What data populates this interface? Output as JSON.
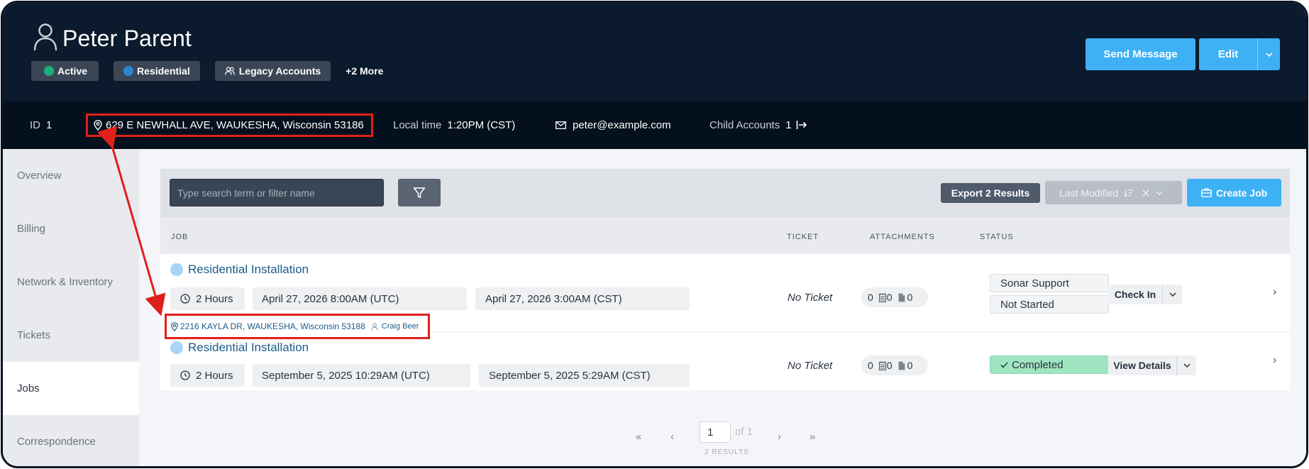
{
  "header": {
    "name": "Peter Parent",
    "tags": [
      {
        "label": "Active",
        "color": "#1bb07a"
      },
      {
        "label": "Residential",
        "color": "#2c86d0"
      },
      {
        "label": "Legacy Accounts"
      }
    ],
    "more_label": "+2 More",
    "send_message_label": "Send Message",
    "edit_label": "Edit"
  },
  "info": {
    "id_label": "ID",
    "id_value": "1",
    "address": "629 E NEWHALL AVE, WAUKESHA, Wisconsin 53186",
    "local_time_label": "Local time",
    "local_time_value": "1:20PM (CST)",
    "email": "peter@example.com",
    "child_accounts_label": "Child Accounts",
    "child_accounts_value": "1"
  },
  "sidebar": {
    "items": [
      "Overview",
      "Billing",
      "Network & Inventory",
      "Tickets",
      "Jobs",
      "Correspondence"
    ],
    "selected": "Jobs"
  },
  "toolbar": {
    "search_placeholder": "Type search term or filter name",
    "export_label": "Export 2 Results",
    "sort_label": "Last Modified",
    "create_label": "Create Job"
  },
  "table": {
    "headers": [
      "JOB",
      "TICKET",
      "ATTACHMENTS",
      "STATUS"
    ],
    "rows": [
      {
        "title": "Residential Installation",
        "duration": "2 Hours",
        "utc": "April 27, 2026 8:00AM (UTC)",
        "local": "April 27, 2026 3:00AM (CST)",
        "address": "2216 KAYLA DR, WAUKESHA, Wisconsin 53188",
        "technician": "Craig Beer",
        "ticket": "No Ticket",
        "attachments": [
          "0",
          "0",
          "0"
        ],
        "status_group": "Sonar Support",
        "status": "Not Started",
        "action": "Check In"
      },
      {
        "title": "Residential Installation",
        "duration": "2 Hours",
        "utc": "September 5, 2025 10:29AM (UTC)",
        "local": "September 5, 2025 5:29AM (CST)",
        "ticket": "No Ticket",
        "attachments": [
          "0",
          "0",
          "0"
        ],
        "status": "Completed",
        "status_color": "#a0e5c1",
        "action": "View Details"
      }
    ]
  },
  "pagination": {
    "page": "1",
    "of_label": "of 1",
    "results_label": "2 RESULTS",
    "first": "«",
    "prev": "‹",
    "next": "›",
    "last": "»"
  },
  "colors": {
    "accent": "#3eb1f5",
    "header_bg": "#0b1a2c",
    "annotation": "#e0201a"
  }
}
